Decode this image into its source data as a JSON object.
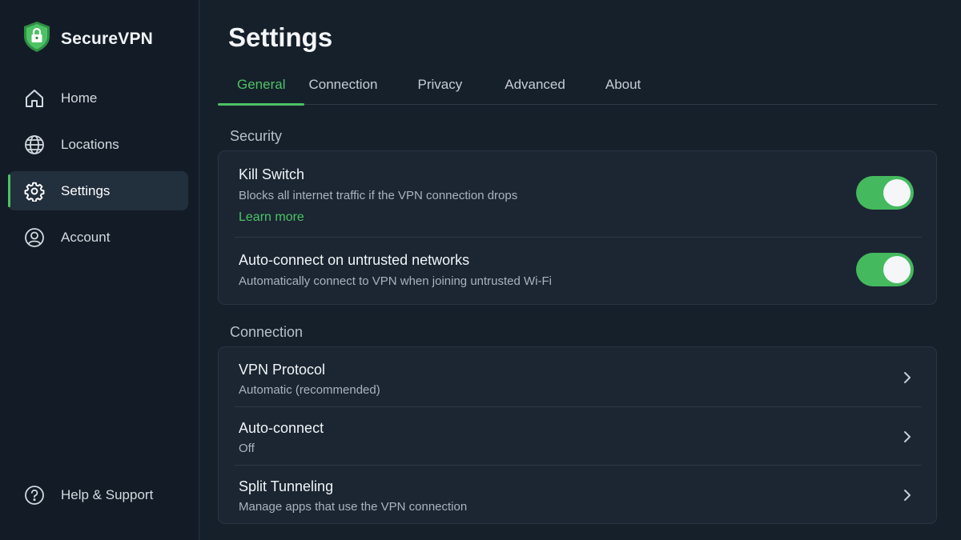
{
  "brand": {
    "name": "SecureVPN"
  },
  "sidebar": {
    "items": [
      {
        "label": "Home",
        "icon": "home-icon"
      },
      {
        "label": "Locations",
        "icon": "globe-icon"
      },
      {
        "label": "Settings",
        "icon": "gear-icon",
        "active": true
      },
      {
        "label": "Account",
        "icon": "user-icon"
      }
    ],
    "help_label": "Help & Support"
  },
  "main": {
    "title": "Settings",
    "tabs": [
      {
        "label": "General",
        "active": true
      },
      {
        "label": "Connection"
      },
      {
        "label": "Privacy"
      },
      {
        "label": "Advanced"
      },
      {
        "label": "About"
      }
    ]
  },
  "security": {
    "section_title": "Security",
    "kill_switch": {
      "title": "Kill Switch",
      "description": "Blocks all internet traffic if the VPN connection drops",
      "link": "Learn more",
      "enabled": true
    },
    "auto_connect_untrusted": {
      "title": "Auto-connect on untrusted networks",
      "description": "Automatically connect to VPN when joining untrusted Wi-Fi",
      "enabled": true
    }
  },
  "connection": {
    "section_title": "Connection",
    "items": [
      {
        "title": "VPN Protocol",
        "value": "Automatic (recommended)"
      },
      {
        "title": "Auto-connect",
        "value": "Off"
      },
      {
        "title": "Split Tunneling",
        "value": "Manage apps that use the VPN connection"
      }
    ]
  },
  "colors": {
    "accent": "#4cc265",
    "background": "#16202b",
    "sidebar": "#131c26",
    "card": "#1b2632"
  }
}
